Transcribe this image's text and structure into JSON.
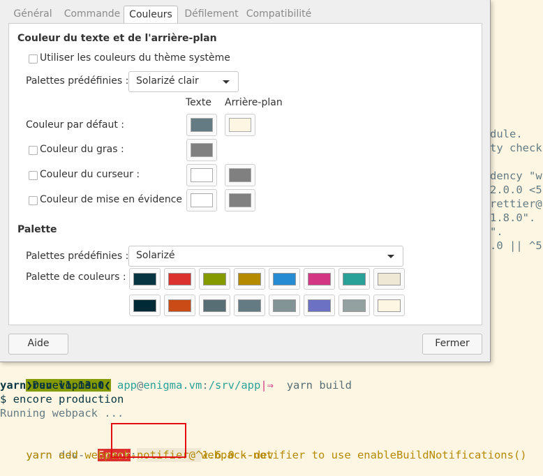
{
  "dialog": {
    "tabs": [
      "Général",
      "Commande",
      "Couleurs",
      "Défilement",
      "Compatibilité"
    ],
    "active_tab": "Couleurs",
    "section_text_bg": "Couleur du texte et de l'arrière-plan",
    "use_system_theme": "Utiliser les couleurs du thème système",
    "builtin_schemes_label": "Palettes prédéfinies :",
    "builtin_schemes_value": "Solarizé clair",
    "col_text": "Texte",
    "col_background": "Arrière-plan",
    "default_color": "Couleur par défaut :",
    "bold_color": "Couleur du gras :",
    "cursor_color": "Couleur du curseur :",
    "highlight_color": "Couleur de mise en évidence :",
    "swatches": {
      "default_text": "#657b83",
      "default_bg": "#fdf6e3",
      "bold": "#808080",
      "cursor_text": "#ffffff",
      "cursor_bg": "#808080",
      "highlight_text": "#ffffff",
      "highlight_bg": "#808080"
    },
    "section_palette": "Palette",
    "palette_builtin_label": "Palettes prédéfinies :",
    "palette_builtin_value": "Solarizé",
    "palette_colors_label": "Palette de couleurs :",
    "palette_row1": [
      "#073642",
      "#dc322f",
      "#859900",
      "#b58900",
      "#268bd2",
      "#d33682",
      "#2aa198",
      "#eee8d5"
    ],
    "palette_row2": [
      "#002b36",
      "#cb4b16",
      "#586e75",
      "#657b83",
      "#839496",
      "#6c71c4",
      "#93a1a1",
      "#fdf6e3"
    ],
    "help_button": "Aide",
    "close_button": "Fermer"
  },
  "terminal": {
    "bg_fragments": [
      "dule.",
      "ty check",
      "dency \"w",
      "2.0.0 <5",
      "rettier@",
      "1.8.0\".",
      "\".",
      ".0 || ^5"
    ],
    "prompt_env": "❯Development❮",
    "prompt_user": "app",
    "prompt_at": "@",
    "prompt_host": "enigma.vm",
    "prompt_path_sep": ":",
    "prompt_path": "/srv/app",
    "prompt_git": "|⇒",
    "command": "yarn build",
    "line_yarn_run": "yarn run v1.13.0",
    "line_encore": "$ encore production",
    "line_running": "Running webpack ...",
    "error_prefix": "yarn dev-",
    "error_word": "Error",
    "error_colon": ":",
    "error_rest": "webpack-notifier to use enableBuildNotifications()",
    "error_line2": "    yarn add webpack-notifier@^1.6.0 --dev"
  }
}
